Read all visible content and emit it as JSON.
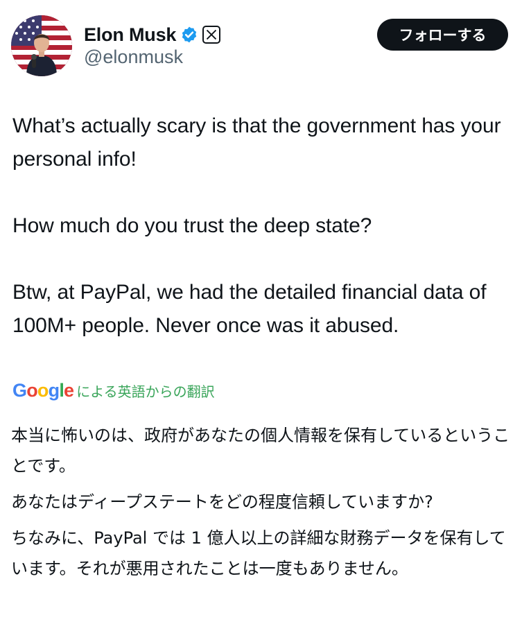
{
  "author": {
    "display_name": "Elon Musk",
    "handle": "@elonmusk"
  },
  "follow_button": {
    "label": "フォローする"
  },
  "tweet": {
    "paragraphs": [
      "What’s actually scary is that the government has your personal info!",
      "How much do you trust the deep state?",
      "Btw, at PayPal, we had the detailed financial data of 100M+ people. Never once was it abused."
    ]
  },
  "translation": {
    "provider_logo": [
      "G",
      "o",
      "o",
      "g",
      "l",
      "e"
    ],
    "caption": "による英語からの翻訳",
    "paragraphs": [
      "本当に怖いのは、政府があなたの個人情報を保有しているということです。",
      "あなたはディープステートをどの程度信頼していますか?",
      "ちなみに、PayPal では 1 億人以上の詳細な財務データを保有しています。それが悪用されたことは一度もありません。"
    ]
  },
  "icons": {
    "verified": "verified-badge-icon",
    "x_logo": "x-logo-icon"
  },
  "colors": {
    "verified_blue": "#1d9bf0",
    "follow_button_bg": "#0f1419",
    "translation_green": "#3aa55a",
    "handle_gray": "#536471"
  }
}
